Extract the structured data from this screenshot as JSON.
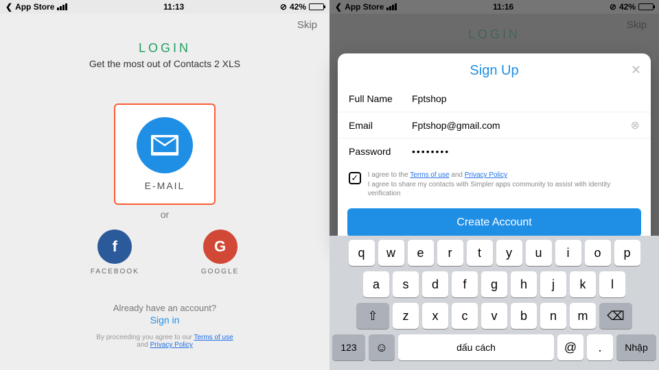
{
  "screen1": {
    "status": {
      "back": "App Store",
      "time": "11:13",
      "battery_pct": "42%",
      "battery_fill": "42%"
    },
    "skip": "Skip",
    "title": "LOGIN",
    "subtitle": "Get the most out of Contacts 2 XLS",
    "email_card": {
      "label": "E-MAIL"
    },
    "or": "or",
    "socials": {
      "facebook": "FACEBOOK",
      "google": "GOOGLE",
      "fb_glyph": "f",
      "gg_glyph": "G"
    },
    "already_q": "Already have an account?",
    "signin": "Sign in",
    "footer_pre": "By proceeding you agree to our ",
    "footer_terms": "Terms of use",
    "footer_and": " and ",
    "footer_privacy": "Privacy Policy"
  },
  "screen2": {
    "status": {
      "back": "App Store",
      "time": "11:16",
      "battery_pct": "42%",
      "battery_fill": "42%"
    },
    "skip": "Skip",
    "title_behind": "LOGIN",
    "modal": {
      "title": "Sign Up",
      "close": "✕",
      "fullname_label": "Full Name",
      "fullname_value": "Fptshop",
      "email_label": "Email",
      "email_value": "Fptshop@gmail.com",
      "email_clear": "⊗",
      "password_label": "Password",
      "password_value": "••••••••",
      "agree_pre": "I agree to the ",
      "agree_terms": "Terms of use",
      "agree_and": " and ",
      "agree_privacy": "Privacy Policy",
      "agree_line2": "I agree to share my contacts with Simpler apps community to assist with identity verification",
      "chk": "✓",
      "create": "Create Account"
    },
    "kbd": {
      "r1": [
        "q",
        "w",
        "e",
        "r",
        "t",
        "y",
        "u",
        "i",
        "o",
        "p"
      ],
      "r2": [
        "a",
        "s",
        "d",
        "f",
        "g",
        "h",
        "j",
        "k",
        "l"
      ],
      "r3": [
        "z",
        "x",
        "c",
        "v",
        "b",
        "n",
        "m"
      ],
      "shift": "⇧",
      "back": "⌫",
      "num": "123",
      "emoji": "☺",
      "space": "dấu cách",
      "at": "@",
      "dot": ".",
      "enter": "Nhập"
    }
  }
}
